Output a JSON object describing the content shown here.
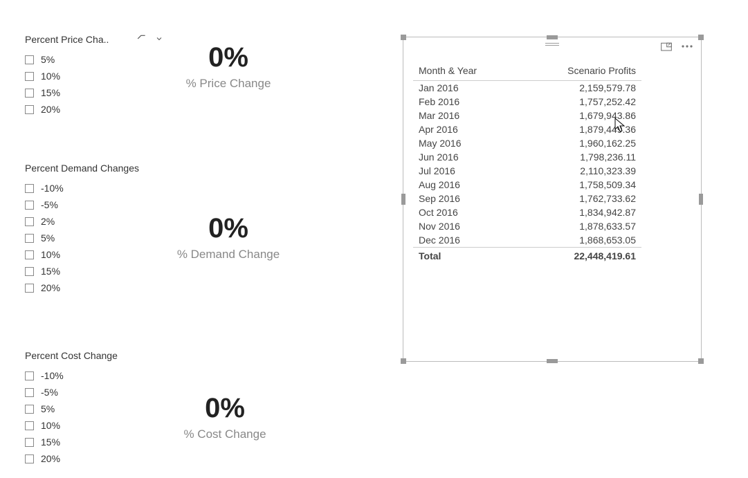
{
  "slicers": {
    "price": {
      "title": "Percent Price Cha..",
      "options": [
        "5%",
        "10%",
        "15%",
        "20%"
      ]
    },
    "demand": {
      "title": "Percent Demand Changes",
      "options": [
        "-10%",
        "-5%",
        "2%",
        "5%",
        "10%",
        "15%",
        "20%"
      ]
    },
    "cost": {
      "title": "Percent Cost Change",
      "options": [
        "-10%",
        "-5%",
        "5%",
        "10%",
        "15%",
        "20%"
      ]
    }
  },
  "cards": {
    "price": {
      "value": "0%",
      "label": "% Price Change"
    },
    "demand": {
      "value": "0%",
      "label": "% Demand Change"
    },
    "cost": {
      "value": "0%",
      "label": "% Cost Change"
    }
  },
  "table": {
    "headers": {
      "col1": "Month & Year",
      "col2": "Scenario Profits"
    },
    "rows": [
      {
        "month": "Jan 2016",
        "value": "2,159,579.78"
      },
      {
        "month": "Feb 2016",
        "value": "1,757,252.42"
      },
      {
        "month": "Mar 2016",
        "value": "1,679,943.86"
      },
      {
        "month": "Apr 2016",
        "value": "1,879,449.36"
      },
      {
        "month": "May 2016",
        "value": "1,960,162.25"
      },
      {
        "month": "Jun 2016",
        "value": "1,798,236.11"
      },
      {
        "month": "Jul 2016",
        "value": "2,110,323.39"
      },
      {
        "month": "Aug 2016",
        "value": "1,758,509.34"
      },
      {
        "month": "Sep 2016",
        "value": "1,762,733.62"
      },
      {
        "month": "Oct 2016",
        "value": "1,834,942.87"
      },
      {
        "month": "Nov 2016",
        "value": "1,878,633.57"
      },
      {
        "month": "Dec 2016",
        "value": "1,868,653.05"
      }
    ],
    "total": {
      "label": "Total",
      "value": "22,448,419.61"
    }
  }
}
